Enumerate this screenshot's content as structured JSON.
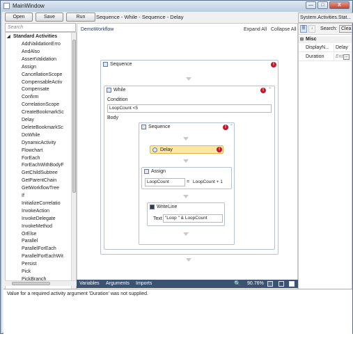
{
  "window": {
    "title": "MainWindow",
    "min": "—",
    "max": "□",
    "close": "X"
  },
  "toolbar": {
    "open": "Open",
    "save": "Save",
    "run": "Run"
  },
  "breadcrumb": "Sequence - While - Sequence - Delay",
  "toolbox": {
    "search_placeholder": "Search",
    "category": "Standard Activities",
    "items": [
      "AddValidationErro",
      "AndAlso",
      "AssertValidation",
      "Assign",
      "CancellationScope",
      "CompensableActiv",
      "Compensate",
      "Confirm",
      "CorrelationScope",
      "CreateBookmarkSc",
      "Delay",
      "DeleteBookmarkSc",
      "DoWhile",
      "DynamicActivity",
      "Flowchart",
      "ForEach",
      "ForEachWithBodyF",
      "GetChildSubtree",
      "GetParentChain",
      "GetWorkflowTree",
      "If",
      "InitializeCorrelatio",
      "InvokeAction",
      "InvokeDelegate",
      "InvokeMethod",
      "OrElse",
      "Parallel",
      "ParallelForEach",
      "ParallelForEachWit",
      "Persist",
      "Pick",
      "PickBranch"
    ]
  },
  "designer": {
    "workflow_name": "DemoWorkflow",
    "expand_all": "Expand All",
    "collapse_all": "Collapse All",
    "outer_sequence": "Sequence",
    "while_title": "While",
    "condition_label": "Condition",
    "condition_value": "LoopCount <5",
    "body_label": "Body",
    "inner_sequence": "Sequence",
    "delay": "Delay",
    "assign_title": "Assign",
    "assign_to": "LoopCount",
    "assign_eq": "=",
    "assign_value": "LoopCount + 1",
    "writeline_title": "WriteLine",
    "text_label": "Text",
    "text_value": "\"Loop \" & LoopCount",
    "error_glyph": "!"
  },
  "statusbar": {
    "variables": "Variables",
    "arguments": "Arguments",
    "imports": "Imports",
    "zoom": "90.76%",
    "zoom_icon": "🔍"
  },
  "properties": {
    "title": "System.Activities.Stat...",
    "search": "Search:",
    "clear": "Clea",
    "category": "Misc",
    "rows": [
      {
        "name": "DisplayN...",
        "value": "Delay"
      },
      {
        "name": "Duration",
        "value": "Ent"
      }
    ],
    "ellipsis": "..."
  },
  "errors": {
    "message": "Value for a required activity argument 'Duration' was not supplied."
  }
}
